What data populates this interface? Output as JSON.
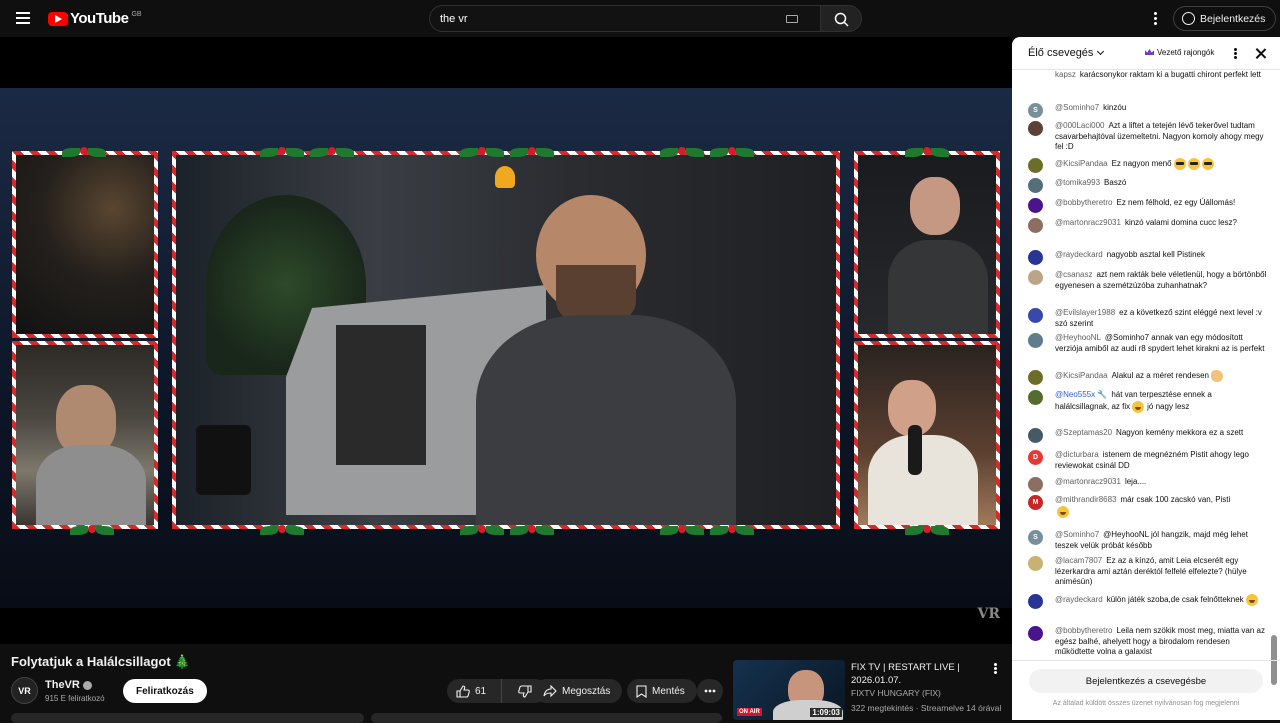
{
  "header": {
    "logo_text": "YouTube",
    "country": "GB",
    "search_value": "the vr",
    "signin_label": "Bejelentkezés"
  },
  "video": {
    "title": "Folytatjuk a Halálcsillagot 🎄",
    "watermark": "VR",
    "channel": {
      "name": "TheVR",
      "avatar_text": "VR",
      "subscribers": "915 E feliratkozó",
      "subscribe_label": "Feliratkozás"
    },
    "actions": {
      "likes": "61",
      "share_label": "Megosztás",
      "save_label": "Mentés"
    }
  },
  "recommendation": {
    "title": "FIX TV | RESTART LIVE | 2026.01.07.",
    "channel": "FIXTV HUNGARY (FIX)",
    "meta": "322 megtekintés · Streamelve 14 órával ezelőtt",
    "duration": "1:09:03",
    "badge": "ON AIR"
  },
  "chat": {
    "title": "Élő csevegés",
    "leader_label": "Vezető rajongók",
    "login_label": "Bejelentkezés a csevegésbe",
    "notice": "Az általad küldött összes üzenet nyilvánosan fog megjelenni",
    "messages": [
      {
        "author": "kapsz",
        "text": "karácsonykor raktam ki a bugatti chiront perfekt lett",
        "avatar": "",
        "color": "#888888",
        "mod": false
      },
      {
        "author": "@Sominho7",
        "text": "kinzóu",
        "avatar": "S",
        "color": "#78909c",
        "mod": false
      },
      {
        "author": "@000Laci000",
        "text": "Azt a liftet a tetején lévő tekerővel tudtam csavarbehajtóval üzemeltetni. Nagyon komoly ahogy megy fel :D",
        "avatar": "",
        "color": "#5d4037",
        "mod": false
      },
      {
        "author": "@KicsiPandaa",
        "text": "Ez nagyon menő",
        "avatar": "",
        "color": "#6d6d2a",
        "mod": false,
        "emoji": "cool",
        "emoji_count": 3
      },
      {
        "author": "@tomika993",
        "text": "Baszó",
        "avatar": "",
        "color": "#546e7a",
        "mod": false
      },
      {
        "author": "@bobbytheretro",
        "text": "Ez nem félhold, ez egy Úállomás!",
        "avatar": "",
        "color": "#4a148c",
        "mod": false
      },
      {
        "author": "@martonracz9031",
        "text": "kinzó valami domina cucc lesz?",
        "avatar": "",
        "color": "#8d6e63",
        "mod": false
      },
      {
        "author": "@raydeckard",
        "text": "nagyobb asztal kell Pistinek",
        "avatar": "",
        "color": "#283593",
        "mod": false
      },
      {
        "author": "@csanasz",
        "text": "azt nem rakták bele véletlenül, hogy a börtönből egyenesen a szemétzúzóba zuhanhatnak?",
        "avatar": "",
        "color": "#bca48a",
        "mod": false
      },
      {
        "author": "@Evilslayer1988",
        "text": "ez a következő szint eléggé next level :v szó szerint",
        "avatar": "",
        "color": "#3949ab",
        "mod": false
      },
      {
        "author": "@HeyhooNL",
        "text": "@Sominho7 annak van egy módosított verziója amiből az audi r8 spydert lehet kirakni az is perfekt",
        "avatar": "",
        "color": "#607d8b",
        "mod": false
      },
      {
        "author": "@KicsiPandaa",
        "text": "Alakul az a méret rendesen",
        "avatar": "",
        "color": "#6d6d2a",
        "mod": false,
        "emoji": "muscle",
        "emoji_count": 1
      },
      {
        "author": "@Neo555x 🔧",
        "text": "hát van terpesztése ennek a halálcsillagnak, az fix",
        "text2": "jó nagy lesz",
        "avatar": "",
        "color": "#556b2f",
        "mod": true,
        "emoji": "grin",
        "emoji_count": 1
      },
      {
        "author": "@Szeptamas20",
        "text": "Nagyon kemény mekkora ez a szett",
        "avatar": "",
        "color": "#455a64",
        "mod": false
      },
      {
        "author": "@dicturbara",
        "text": "istenem de megnézném Pistit ahogy lego reviewokat csinál DD",
        "avatar": "D",
        "color": "#e53935",
        "mod": false
      },
      {
        "author": "@martonracz9031",
        "text": "leja....",
        "avatar": "",
        "color": "#8d6e63",
        "mod": false
      },
      {
        "author": "@mithrandir8683",
        "text": "már csak 100 zacskó van, Pisti",
        "avatar": "M",
        "color": "#c62828",
        "mod": false,
        "emoji": "grin",
        "emoji_count": 1,
        "emoji_newline": true
      },
      {
        "author": "@Sominho7",
        "text": "@HeyhooNL jól hangzik, majd még lehet teszek velük próbát később",
        "avatar": "S",
        "color": "#78909c",
        "mod": false
      },
      {
        "author": "@lacam7807",
        "text": "Ez az a kínzó, amit Leia elcserélt egy lézerkardra ami aztán deréktól felfelé elfelezte? (hülye animésün)",
        "avatar": "",
        "color": "#c8b273",
        "mod": false
      },
      {
        "author": "@raydeckard",
        "text": "külön játék szoba,de csak felnőtteknek",
        "avatar": "",
        "color": "#283593",
        "mod": false,
        "emoji": "grin",
        "emoji_count": 1
      },
      {
        "author": "@bobbytheretro",
        "text": "Leila nem szökik most meg, miatta van az egész balhé, ahelyett hogy a birodalom rendesen működtette volna a galaxist",
        "avatar": "",
        "color": "#4a148c",
        "mod": false
      }
    ]
  },
  "colors": {
    "accent_red": "#ff0000",
    "chat_bg": "#ffffff",
    "page_bg": "#0f0f0f"
  }
}
